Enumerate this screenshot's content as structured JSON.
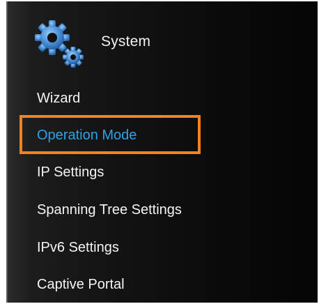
{
  "header": {
    "icon": "gears-icon",
    "title": "System"
  },
  "menu": {
    "items": [
      {
        "label": "Wizard",
        "active": false
      },
      {
        "label": "Operation Mode",
        "active": true
      },
      {
        "label": "IP Settings",
        "active": false
      },
      {
        "label": "Spanning Tree Settings",
        "active": false
      },
      {
        "label": "IPv6 Settings",
        "active": false
      },
      {
        "label": "Captive Portal",
        "active": false
      }
    ]
  },
  "colors": {
    "active_text": "#2ea3e6",
    "highlight_border": "#f58220",
    "gear_fill": "#4a90d9"
  }
}
